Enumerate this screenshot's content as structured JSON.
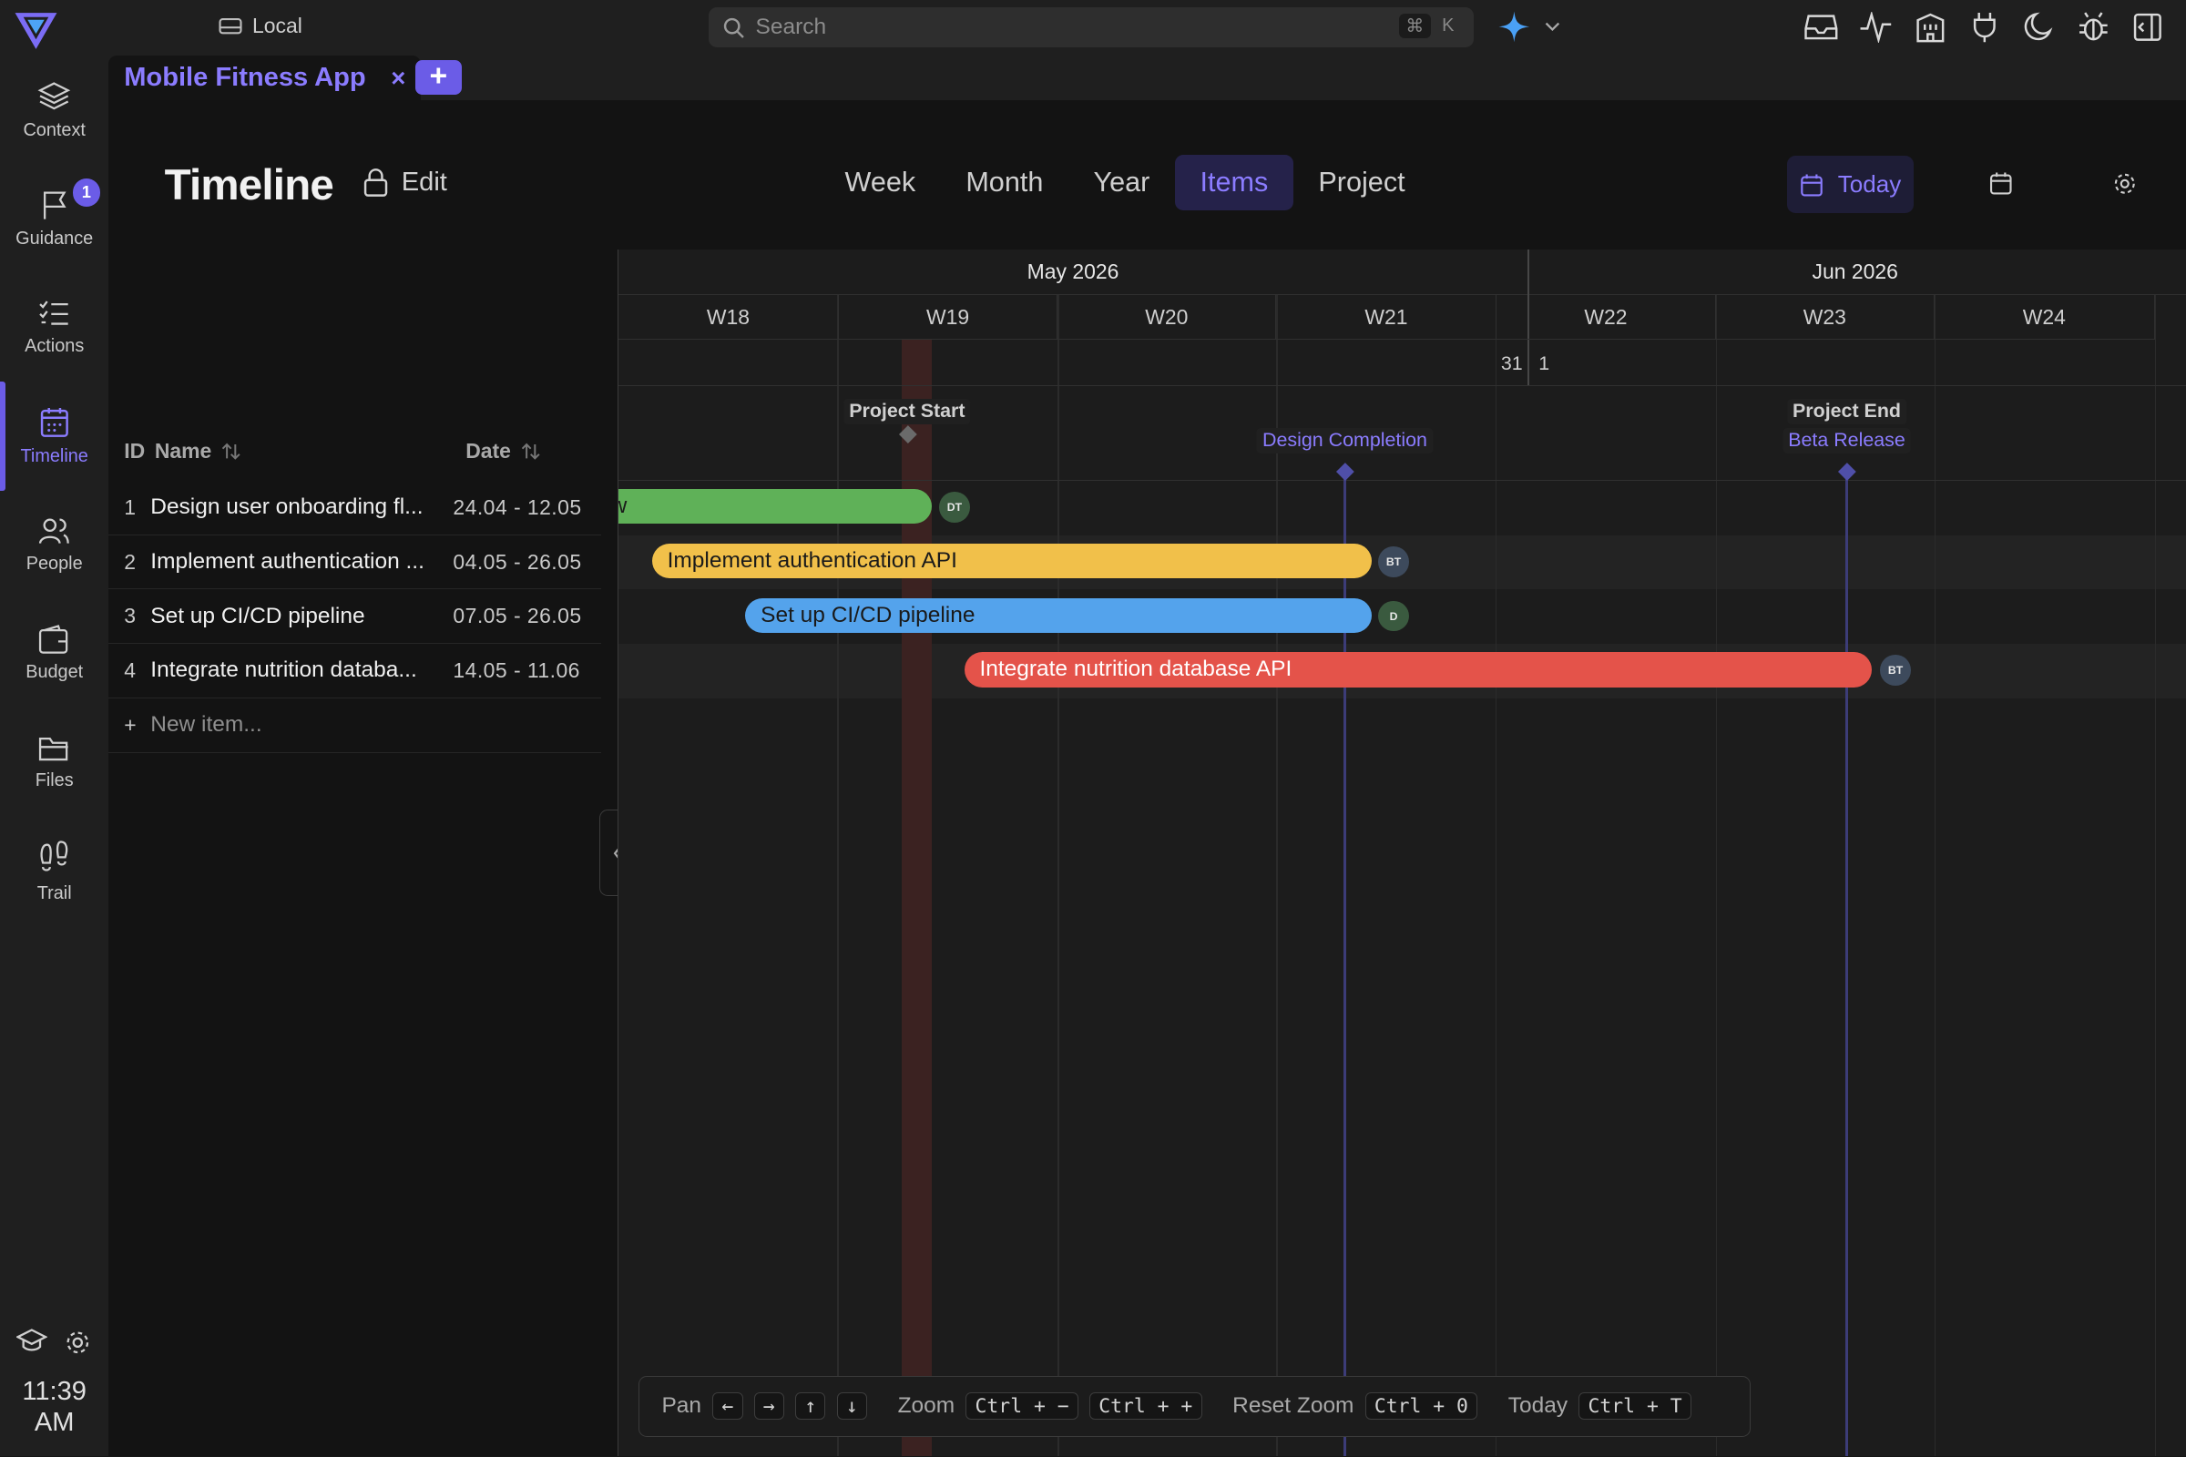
{
  "topbar": {
    "workspace": "Local",
    "search_placeholder": "Search",
    "search_shortcut": [
      "⌘",
      "K"
    ]
  },
  "tab": {
    "title": "Mobile Fitness App",
    "close": "×",
    "add": "+"
  },
  "sidebar": {
    "items": [
      {
        "label": "Context",
        "icon": "layers-icon"
      },
      {
        "label": "Guidance",
        "icon": "flag-icon",
        "badge": "1"
      },
      {
        "label": "Actions",
        "icon": "checklist-icon"
      },
      {
        "label": "Timeline",
        "icon": "calendar-icon",
        "active": true
      },
      {
        "label": "People",
        "icon": "people-icon"
      },
      {
        "label": "Budget",
        "icon": "wallet-icon"
      },
      {
        "label": "Files",
        "icon": "folder-icon"
      },
      {
        "label": "Trail",
        "icon": "footprints-icon"
      }
    ],
    "clock_time": "11:39",
    "clock_ampm": "AM"
  },
  "header": {
    "title": "Timeline",
    "edit_label": "Edit",
    "view_tabs": [
      "Week",
      "Month",
      "Year",
      "Items",
      "Project"
    ],
    "active_view": "Items",
    "today_label": "Today"
  },
  "list": {
    "col_id": "ID",
    "col_name": "Name",
    "col_date": "Date",
    "rows": [
      {
        "id": "1",
        "name": "Design user onboarding fl...",
        "date": "24.04 - 12.05"
      },
      {
        "id": "2",
        "name": "Implement authentication ...",
        "date": "04.05 - 26.05"
      },
      {
        "id": "3",
        "name": "Set up CI/CD pipeline",
        "date": "07.05 - 26.05"
      },
      {
        "id": "4",
        "name": "Integrate nutrition databa...",
        "date": "14.05 - 11.06"
      }
    ],
    "new_item": "New item...",
    "new_item_plus": "+"
  },
  "gantt": {
    "months": [
      "May 2026",
      "Jun 2026"
    ],
    "weeks": [
      "W18",
      "W19",
      "W20",
      "W21",
      "W22",
      "W23",
      "W24"
    ],
    "day_labels": [
      "31",
      "1"
    ],
    "milestones": {
      "project_start": "Project Start",
      "design_completion": "Design Completion",
      "project_end": "Project End",
      "beta_release": "Beta Release"
    },
    "bars": [
      {
        "label": "w",
        "color": "#5fb158",
        "assignee": "DT"
      },
      {
        "label": "Implement authentication API",
        "color": "#f1c04a",
        "assignee": "BT"
      },
      {
        "label": "Set up CI/CD pipeline",
        "color": "#54a3ec",
        "assignee": "D"
      },
      {
        "label": "Integrate nutrition database API",
        "color": "#e4534a",
        "assignee": "BT",
        "text_color": "#ffffff"
      }
    ]
  },
  "shortcuts": {
    "pan": "Pan",
    "pan_keys": [
      "←",
      "→",
      "↑",
      "↓"
    ],
    "zoom": "Zoom",
    "zoom_out": "Ctrl + −",
    "zoom_in": "Ctrl + +",
    "reset_zoom": "Reset Zoom",
    "reset_key": "Ctrl + 0",
    "today": "Today",
    "today_key": "Ctrl + T"
  },
  "colors": {
    "accent": "#6b5ce7",
    "accent_text": "#8b7cff"
  }
}
